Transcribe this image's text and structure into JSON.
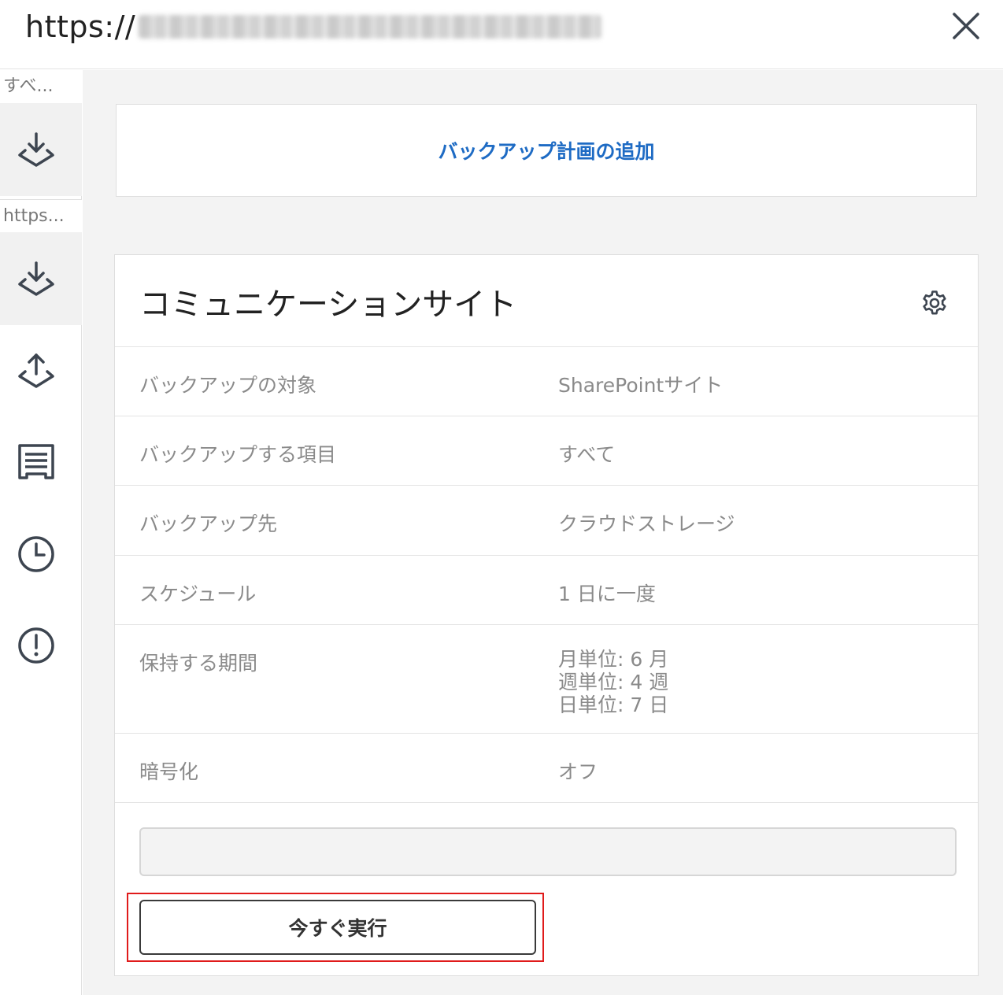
{
  "titlebar": {
    "url_prefix": "https://",
    "url_rest": "[blurred address]"
  },
  "sidebar": {
    "labels": [
      "すべ...",
      "https..."
    ],
    "icons": [
      "download-icon",
      "download-icon",
      "upload-icon",
      "report-icon",
      "clock-icon",
      "alert-icon"
    ]
  },
  "main": {
    "add_plan_label": "バックアップ計画の追加",
    "plan": {
      "title": "コミュニケーションサイト",
      "rows": [
        {
          "key": "バックアップの対象",
          "value": "SharePointサイト"
        },
        {
          "key": "バックアップする項目",
          "value": "すべて"
        },
        {
          "key": "バックアップ先",
          "value": "クラウドストレージ"
        },
        {
          "key": "スケジュール",
          "value": "1 日に一度"
        },
        {
          "key": "保持する期間",
          "values": [
            "月単位: 6 月",
            "週単位: 4 週",
            "日単位: 7 日"
          ]
        },
        {
          "key": "暗号化",
          "value": "オフ"
        }
      ],
      "progress_fraction": 0,
      "run_now_label": "今すぐ実行"
    }
  },
  "colors": {
    "link_blue": "#1e6bc4",
    "highlight_red": "#e01b1b",
    "icon_gray": "#3d4550"
  }
}
